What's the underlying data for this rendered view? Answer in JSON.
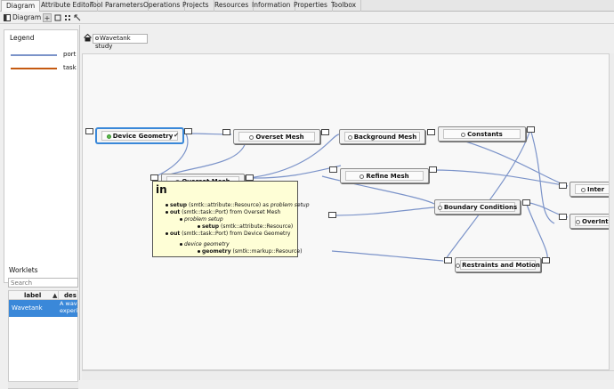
{
  "tabs": [
    "Diagram",
    "Attribute Editor",
    "Tool Parameters",
    "Operations",
    "Projects",
    "Resources",
    "Information",
    "Properties",
    "Toolbox"
  ],
  "toolbar": {
    "panel_label": "Diagram"
  },
  "legend": {
    "title": "Legend",
    "items": [
      {
        "label": "port co",
        "color": "#7b93c9"
      },
      {
        "label": "task de",
        "color": "#c55a11"
      }
    ]
  },
  "worklets": {
    "title": "Worklets",
    "search_placeholder": "Search",
    "columns": [
      "label",
      "▲",
      "des"
    ],
    "rows": [
      {
        "label": "Wavetank",
        "description_line1": "A wave",
        "description_line2": "experim"
      }
    ]
  },
  "breadcrumb": {
    "study": "Wavetank study"
  },
  "nodes": {
    "device_geometry": "Device Geometry",
    "overset_mesh": "Overset Mesh",
    "background_mesh": "Background Mesh",
    "constants": "Constants",
    "refine_mesh": "Refine Mesh",
    "boundary_conditions": "Boundary Conditions",
    "restraints_and_motion": "Restraints and Motion",
    "inter": "Inter",
    "overint": "OverInt",
    "hidden_node": "Overset Mesh"
  },
  "tooltip": {
    "title": "in",
    "line1_bold": "setup",
    "line1_rest": " (smtk::attribute::Resource) as ",
    "line1_italic": "problem setup",
    "line2_bold": "out",
    "line2_rest": " (smtk::task::Port) from Overset Mesh",
    "line3_italic": "problem setup",
    "line4_bold": "setup",
    "line4_rest": " (smtk::attribute::Resource)",
    "line5_bold": "out",
    "line5_rest": " (smtk::task::Port) from Device Geometry",
    "line6_italic": "device geometry",
    "line7_bold": "geometry",
    "line7_rest": " (smtk::markup::Resource)"
  },
  "colors": {
    "accent": "#3a88d9",
    "edge": "#7b93c9",
    "tooltip_bg": "#fefed6"
  }
}
